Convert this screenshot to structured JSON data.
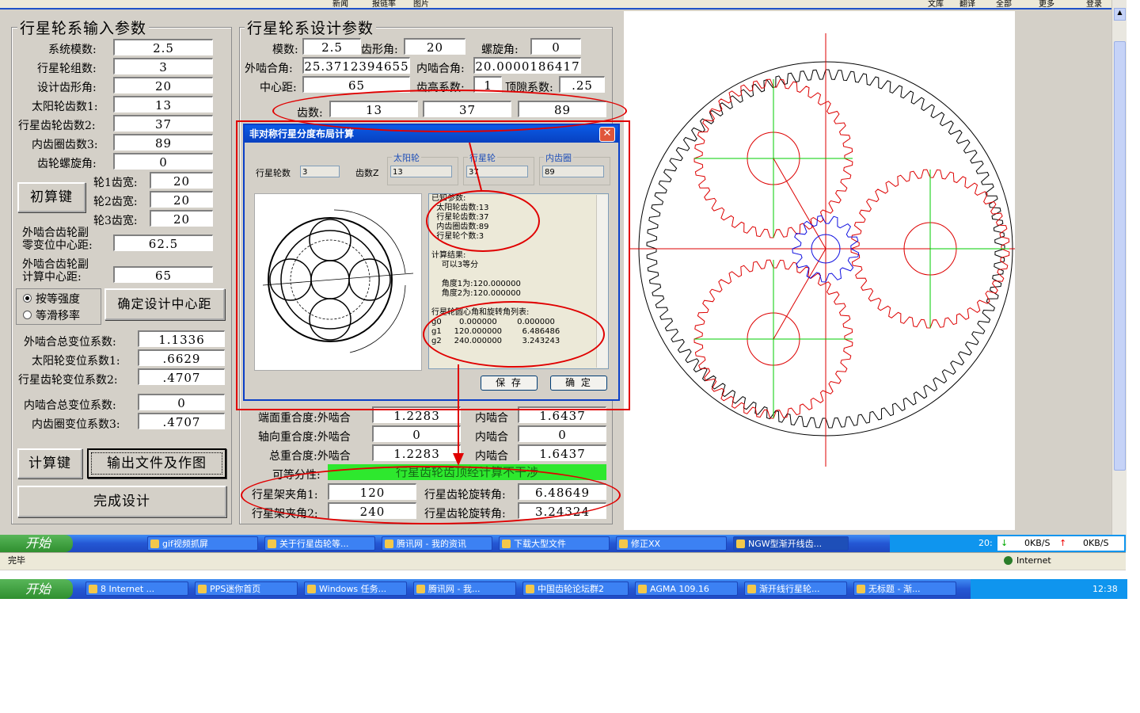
{
  "left_panel": {
    "title": "行星轮系输入参数",
    "rows": [
      {
        "label": "系统模数:",
        "value": "2.5"
      },
      {
        "label": "行星轮组数:",
        "value": "3"
      },
      {
        "label": "设计齿形角:",
        "value": "20"
      },
      {
        "label": "太阳轮齿数1:",
        "value": "13"
      },
      {
        "label": "行星齿轮齿数2:",
        "value": "37"
      },
      {
        "label": "内齿圈齿数3:",
        "value": "89"
      },
      {
        "label": "齿轮螺旋角:",
        "value": "0"
      }
    ],
    "initial_calc_button": "初算键",
    "widths": [
      {
        "label": "轮1齿宽:",
        "value": "20"
      },
      {
        "label": "轮2齿宽:",
        "value": "20"
      },
      {
        "label": "轮3齿宽:",
        "value": "20"
      }
    ],
    "center_dist_zero_label": "外啮合齿轮副\n零变位中心距:",
    "center_dist_zero_value": "62.5",
    "center_dist_calc_label": "外啮合齿轮副\n计算中心距:",
    "center_dist_calc_value": "65",
    "radio_equal_strength": "按等强度",
    "radio_equal_slip": "等滑移率",
    "determine_center_button": "确定设计中心距",
    "shift": [
      {
        "label": "外啮合总变位系数:",
        "value": "1.1336"
      },
      {
        "label": "太阳轮变位系数1:",
        "value": ".6629"
      },
      {
        "label": "行星齿轮变位系数2:",
        "value": ".4707"
      },
      {
        "label": "内啮合总变位系数:",
        "value": "0"
      },
      {
        "label": "内齿圈变位系数3:",
        "value": ".4707"
      }
    ],
    "calc_button": "计算键",
    "output_button": "输出文件及作图",
    "finish_button": "完成设计"
  },
  "design_panel": {
    "title": "行星轮系设计参数",
    "module_label": "模数:",
    "module_value": "2.5",
    "tooth_angle_label": "齿形角:",
    "tooth_angle_value": "20",
    "helix_label": "螺旋角:",
    "helix_value": "0",
    "ext_mesh_label": "外啮合角:",
    "ext_mesh_value": "25.3712394655",
    "int_mesh_label": "内啮合角:",
    "int_mesh_value": "20.0000186417",
    "center_label": "中心距:",
    "center_value": "65",
    "addendum_label": "齿高系数:",
    "addendum_value": "1",
    "clearance_label": "顶隙系数:",
    "clearance_value": ".25",
    "teeth_label": "齿数:",
    "teeth": [
      "13",
      "37",
      "89"
    ],
    "face_contact_label": "端面重合度:外啮合",
    "face_ext": "1.2283",
    "face_int_label": "内啮合",
    "face_int": "1.6437",
    "axial_contact_label": "轴向重合度:外啮合",
    "axial_ext": "0",
    "axial_int_label": "内啮合",
    "axial_int": "0",
    "total_contact_label": "总重合度:外啮合",
    "total_ext": "1.2283",
    "total_int_label": "内啮合",
    "total_int": "1.6437",
    "divisible_label": "可等分性:",
    "divisible_value": "行星齿轮齿顶经计算不干涉",
    "carrier1_label": "行星架夹角1:",
    "carrier1_value": "120",
    "rot1_label": "行星齿轮旋转角:",
    "rot1_value": "6.48649",
    "carrier2_label": "行星架夹角2:",
    "carrier2_value": "240",
    "rot2_label": "行星齿轮旋转角:",
    "rot2_value": "3.24324"
  },
  "dialog": {
    "title": "非对称行星分度布局计算",
    "planet_count_label": "行星轮数",
    "planet_count_value": "3",
    "teeth_label": "齿数Z",
    "sun_label": "太阳轮",
    "sun_value": "13",
    "planet_label": "行星轮",
    "planet_value": "37",
    "ring_label": "内齿圈",
    "ring_value": "89",
    "text_lines": [
      "已知参数:",
      "  太阳轮齿数:13",
      "  行星轮齿数:37",
      "  内齿圈齿数:89",
      "  行星轮个数:3",
      "",
      "计算结果:",
      "    可以3等分",
      "",
      "    角度1为:120.000000",
      "    角度2为:120.000000",
      "",
      "行星轮圆心角和旋转角列表:",
      "g0       0.000000        0.000000",
      "g1     120.000000        6.486486",
      "g2     240.000000        3.243243"
    ],
    "save_button": "保 存",
    "ok_button": "确 定"
  },
  "top_menu": [
    "新闻",
    "报链率",
    "图片",
    "文库",
    "翻译",
    "全部",
    "更多",
    "登录"
  ],
  "status": {
    "left": "完毕",
    "zone": "Internet"
  },
  "inner_taskbar": {
    "start": "开始",
    "items": [
      "gif视频抓屏",
      "关于行星齿轮等...",
      "腾讯网 - 我的资讯",
      "下载大型文件",
      "修正XX",
      "NGW型渐开线齿..."
    ],
    "speed_down": "0KB/S",
    "speed_up": "0KB/S",
    "clock": "20:"
  },
  "outer_taskbar": {
    "start": "开始",
    "items": [
      "8 Internet ...",
      "PPS迷你首页",
      "Windows 任务...",
      "腾讯网 - 我...",
      "中国齿轮论坛群2",
      "AGMA 109.16",
      "渐开线行星轮...",
      "无标题 - 渐..."
    ],
    "clock": "12:38"
  },
  "colors": {
    "accent_red": "#e00000",
    "green_bar": "#2ee82e",
    "gear_black": "#000000",
    "gear_red": "#dd0000",
    "gear_blue": "#1010e0",
    "center_green": "#00cc00"
  }
}
